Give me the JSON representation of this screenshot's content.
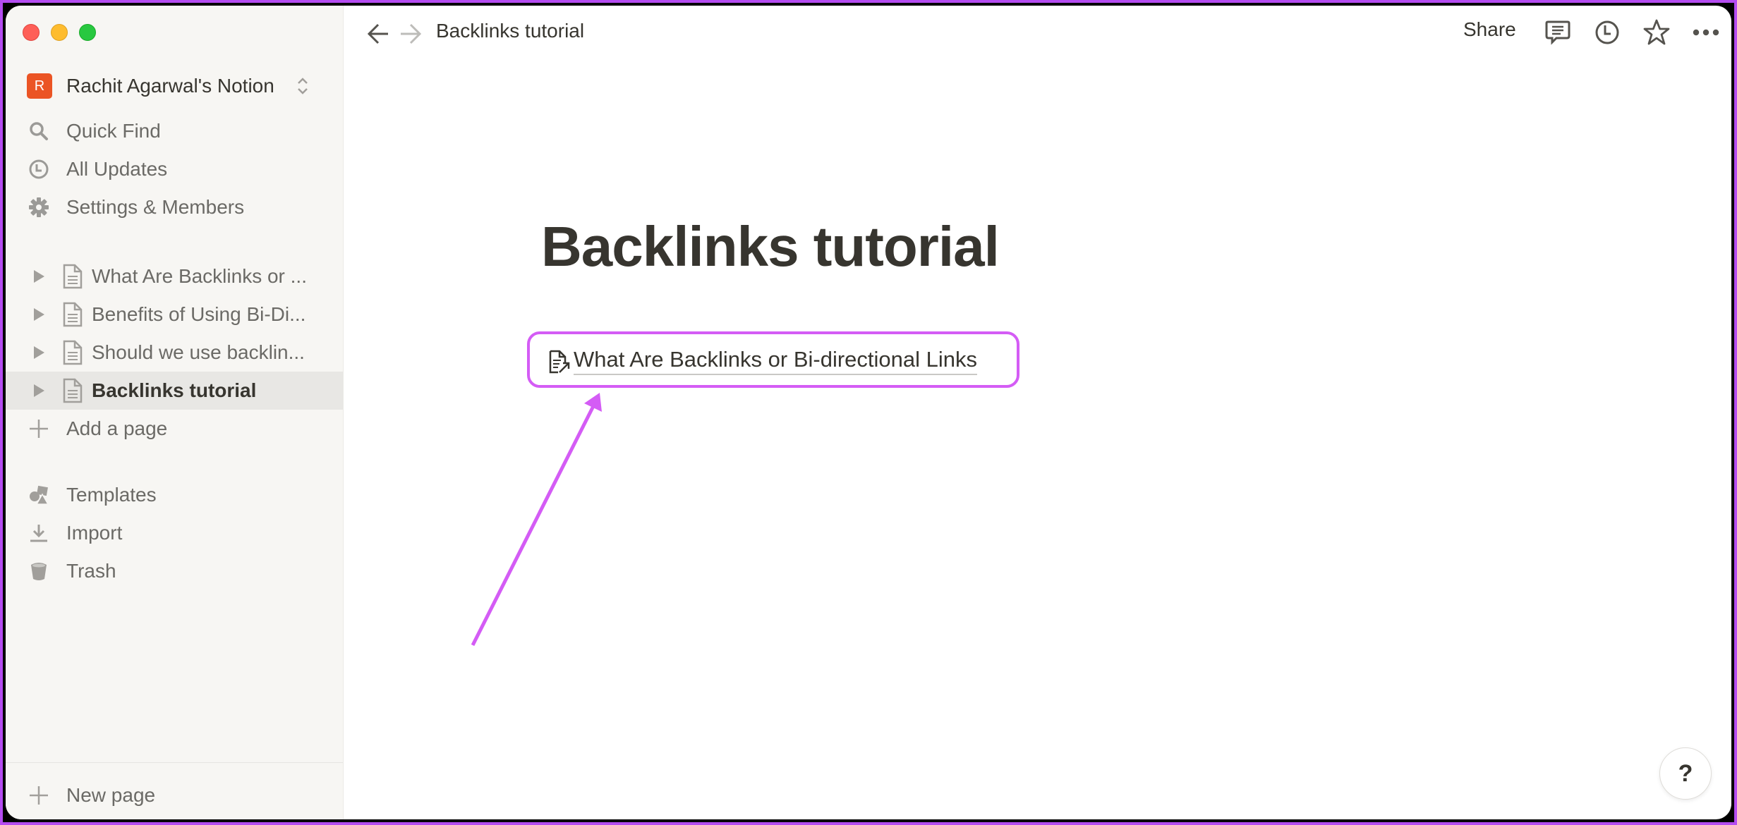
{
  "window": {
    "controls": [
      "close",
      "minimize",
      "zoom"
    ]
  },
  "sidebar": {
    "workspace": {
      "avatar_letter": "R",
      "name": "Rachit Agarwal's Notion",
      "avatar_color": "#eb5424"
    },
    "nav": [
      {
        "label": "Quick Find",
        "icon": "search-icon"
      },
      {
        "label": "All Updates",
        "icon": "clock-icon"
      },
      {
        "label": "Settings & Members",
        "icon": "gear-icon"
      }
    ],
    "pages": [
      {
        "label": "What Are Backlinks or ...",
        "selected": false
      },
      {
        "label": "Benefits of Using Bi-Di...",
        "selected": false
      },
      {
        "label": "Should we use backlin...",
        "selected": false
      },
      {
        "label": "Backlinks tutorial",
        "selected": true
      }
    ],
    "add_page_label": "Add a page",
    "tools": [
      {
        "label": "Templates",
        "icon": "templates-icon"
      },
      {
        "label": "Import",
        "icon": "import-icon"
      },
      {
        "label": "Trash",
        "icon": "trash-icon"
      }
    ],
    "new_page_label": "New page"
  },
  "topbar": {
    "breadcrumb": "Backlinks tutorial",
    "share_label": "Share"
  },
  "page": {
    "title": "Backlinks tutorial",
    "link_to_page": "What Are Backlinks or Bi-directional Links"
  },
  "help": {
    "label": "?"
  },
  "annotation": {
    "color": "#d45cf5"
  }
}
